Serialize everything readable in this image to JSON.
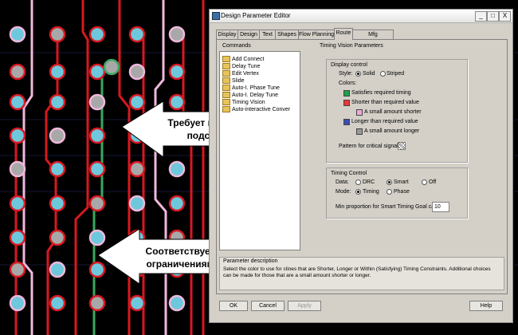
{
  "dialog": {
    "title": "Design Parameter Editor",
    "title_buttons": {
      "minimize": "_",
      "maximize": "□",
      "close": "X"
    },
    "tabs": [
      "Display",
      "Design",
      "Text",
      "Shapes",
      "Flow Planning",
      "Route",
      "Mfg Applications"
    ],
    "active_tab": "Route",
    "commands": {
      "label": "Commands",
      "items": [
        "Add Connect",
        "Delay Tune",
        "Edit Vertex",
        "Slide",
        "Auto-I. Phase Tune",
        "Auto-I. Delay Tune",
        "Timing Vision",
        "Auto-interactive Conver"
      ],
      "selected_item": "Timing Vision"
    },
    "timing_vision": {
      "section_title": "Timing Vision Parameters",
      "display_control": {
        "title": "Display control",
        "style_label": "Style:",
        "style_options": [
          "Solid",
          "Striped"
        ],
        "style_selected": "Solid",
        "colors_label": "Colors:",
        "color_entries": [
          {
            "label": "Satisfies required timing",
            "color": "#22a04a"
          },
          {
            "label": "Shorter than required value",
            "color": "#e83838"
          },
          {
            "label": "A small amount shorter",
            "color": "#f0a8d8"
          },
          {
            "label": "Longer than required value",
            "color": "#3a4fb0"
          },
          {
            "label": "A small amount longer",
            "color": "#9a9a9a"
          }
        ],
        "pattern_label": "Pattern for critical signals:"
      },
      "timing_control": {
        "title": "Timing Control",
        "data_label": "Data:",
        "data_options": [
          "DRC",
          "Smart",
          "Off"
        ],
        "data_selected": "Smart",
        "mode_label": "Mode:",
        "mode_options": [
          "Timing",
          "Phase"
        ],
        "mode_selected": "Timing",
        "min_proportion_label": "Min proportion for Smart Timing Goal calc:",
        "min_proportion_value": "10"
      }
    },
    "parameter_description": {
      "title": "Parameter description",
      "text": "Select the color to use for clines that are Shorter, Longer or Within (Satisfying) Timing Constraints. Additional choices can be made for those that are a small amount shorter or longer."
    },
    "buttons": {
      "ok": "OK",
      "cancel": "Cancel",
      "apply": "Apply",
      "help": "Help"
    }
  },
  "callouts": {
    "top": {
      "line1": "Требует небольшой",
      "line2": "подстройки"
    },
    "bottom": {
      "line1": "Соответствует",
      "line2": "ограничениям"
    }
  },
  "colors": {
    "trace_red": "#d81820",
    "trace_pink": "#f0b8dc",
    "trace_green": "#39a860",
    "pad_cyan": "#6ec8dc",
    "pad_gray": "#a8a8a8",
    "dialog_bg": "#d4d0c8"
  }
}
